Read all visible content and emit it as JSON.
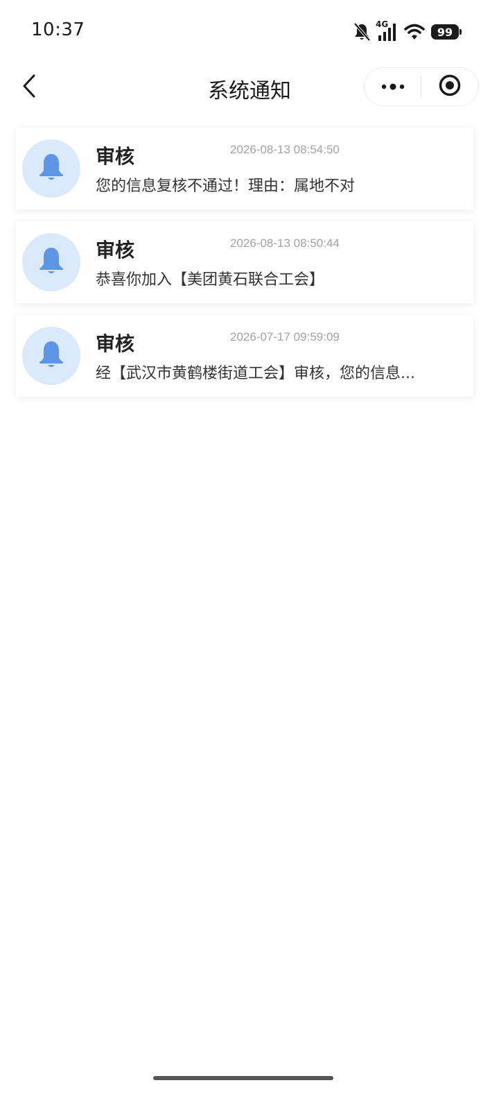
{
  "status_bar": {
    "time": "10:37",
    "network": "4G",
    "battery": "99",
    "icons": [
      "bell-off-icon",
      "signal-icon",
      "wifi-icon",
      "battery-icon"
    ]
  },
  "nav": {
    "title": "系统通知",
    "back_icon": "chevron-left-icon",
    "more_icon": "more-dots-icon",
    "close_icon": "target-circle-icon"
  },
  "colors": {
    "avatar_bg": "#dbe9fc",
    "bell": "#5f95e6",
    "time_text": "#a3a3a3"
  },
  "notifications": [
    {
      "title": "审核",
      "time": "2026-08-13 08:54:50",
      "body": "您的信息复核不通过！理由：属地不对",
      "icon": "bell-icon"
    },
    {
      "title": "审核",
      "time": "2026-08-13 08:50:44",
      "body": "恭喜你加入【美团黄石联合工会】",
      "icon": "bell-icon"
    },
    {
      "title": "审核",
      "time": "2026-07-17 09:59:09",
      "body": "经【武汉市黄鹤楼街道工会】审核，您的信息...",
      "icon": "bell-icon"
    }
  ]
}
